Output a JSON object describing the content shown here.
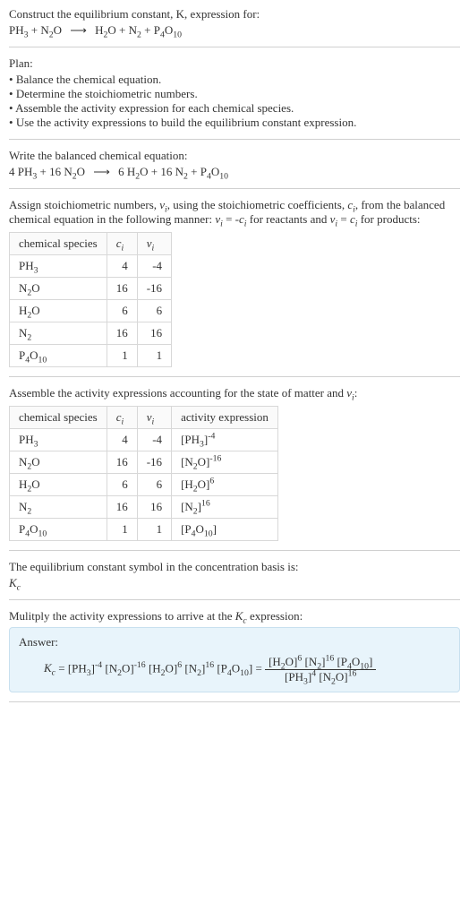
{
  "intro": {
    "line1": "Construct the equilibrium constant, K, expression for:"
  },
  "plan": {
    "heading": "Plan:",
    "items": [
      "Balance the chemical equation.",
      "Determine the stoichiometric numbers.",
      "Assemble the activity expression for each chemical species.",
      "Use the activity expressions to build the equilibrium constant expression."
    ]
  },
  "balanced": {
    "heading": "Write the balanced chemical equation:"
  },
  "stoich": {
    "heading_a": "Assign stoichiometric numbers, ",
    "heading_b": ", using the stoichiometric coefficients, ",
    "heading_c": ", from the balanced chemical equation in the following manner: ",
    "heading_d": " for reactants and ",
    "heading_e": " for products:",
    "table": {
      "h1": "chemical species",
      "h2": "c",
      "h3": "ν",
      "rows": [
        {
          "sp": "PH",
          "sub": "3",
          "c": "4",
          "v": "-4"
        },
        {
          "sp": "N",
          "sub": "2",
          "sp2": "O",
          "c": "16",
          "v": "-16"
        },
        {
          "sp": "H",
          "sub": "2",
          "sp2": "O",
          "c": "6",
          "v": "6"
        },
        {
          "sp": "N",
          "sub": "2",
          "c": "16",
          "v": "16"
        },
        {
          "sp": "P",
          "sub": "4",
          "sp2": "O",
          "sub2": "10",
          "c": "1",
          "v": "1"
        }
      ]
    }
  },
  "activity": {
    "heading_a": "Assemble the activity expressions accounting for the state of matter and ",
    "heading_b": ":",
    "table": {
      "h1": "chemical species",
      "h2": "c",
      "h3": "ν",
      "h4": "activity expression"
    }
  },
  "symbol": {
    "line1": "The equilibrium constant symbol in the concentration basis is:"
  },
  "multiply": {
    "heading_a": "Mulitply the activity expressions to arrive at the ",
    "heading_b": " expression:"
  },
  "answer": {
    "label": "Answer:"
  }
}
